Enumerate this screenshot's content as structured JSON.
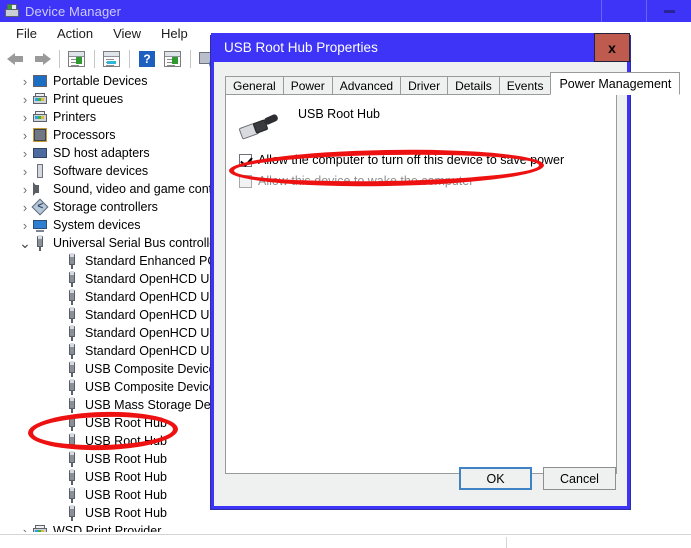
{
  "main_window": {
    "title": "Device Manager",
    "icon": "device-manager-icon",
    "minimize_label": "",
    "menus": [
      "File",
      "Action",
      "View",
      "Help"
    ],
    "toolbar_icons": [
      "back-arrow-icon",
      "forward-arrow-icon",
      "show-hide-console-tree-icon",
      "properties-icon",
      "help-icon",
      "update-driver-icon",
      "scan-for-hardware-changes-icon",
      "devices-by-type-icon"
    ]
  },
  "tree": {
    "items": [
      {
        "label": "Portable Devices",
        "indent": 1,
        "chevron": "collapsed",
        "icon": "portable-device-icon"
      },
      {
        "label": "Print queues",
        "indent": 1,
        "chevron": "collapsed",
        "icon": "printer-icon"
      },
      {
        "label": "Printers",
        "indent": 1,
        "chevron": "collapsed",
        "icon": "printer-icon"
      },
      {
        "label": "Processors",
        "indent": 1,
        "chevron": "collapsed",
        "icon": "processor-icon"
      },
      {
        "label": "SD host adapters",
        "indent": 1,
        "chevron": "collapsed",
        "icon": "sd-card-icon"
      },
      {
        "label": "Software devices",
        "indent": 1,
        "chevron": "collapsed",
        "icon": "software-device-icon"
      },
      {
        "label": "Sound, video and game controllers",
        "indent": 1,
        "chevron": "collapsed",
        "icon": "speaker-icon"
      },
      {
        "label": "Storage controllers",
        "indent": 1,
        "chevron": "collapsed",
        "icon": "storage-controller-icon"
      },
      {
        "label": "System devices",
        "indent": 1,
        "chevron": "collapsed",
        "icon": "system-device-icon"
      },
      {
        "label": "Universal Serial Bus controllers",
        "indent": 1,
        "chevron": "expanded",
        "icon": "usb-icon"
      },
      {
        "label": "Standard Enhanced PCI to USB Host Controller",
        "indent": 2,
        "chevron": "none",
        "icon": "usb-icon"
      },
      {
        "label": "Standard OpenHCD USB Host Controller",
        "indent": 2,
        "chevron": "none",
        "icon": "usb-icon"
      },
      {
        "label": "Standard OpenHCD USB Host Controller",
        "indent": 2,
        "chevron": "none",
        "icon": "usb-icon"
      },
      {
        "label": "Standard OpenHCD USB Host Controller",
        "indent": 2,
        "chevron": "none",
        "icon": "usb-icon"
      },
      {
        "label": "Standard OpenHCD USB Host Controller",
        "indent": 2,
        "chevron": "none",
        "icon": "usb-icon"
      },
      {
        "label": "Standard OpenHCD USB Host Controller",
        "indent": 2,
        "chevron": "none",
        "icon": "usb-icon"
      },
      {
        "label": "USB Composite Device",
        "indent": 2,
        "chevron": "none",
        "icon": "usb-icon"
      },
      {
        "label": "USB Composite Device",
        "indent": 2,
        "chevron": "none",
        "icon": "usb-icon"
      },
      {
        "label": "USB Mass Storage Device",
        "indent": 2,
        "chevron": "none",
        "icon": "usb-icon"
      },
      {
        "label": "USB Root Hub",
        "indent": 2,
        "chevron": "none",
        "icon": "usb-icon"
      },
      {
        "label": "USB Root Hub",
        "indent": 2,
        "chevron": "none",
        "icon": "usb-icon"
      },
      {
        "label": "USB Root Hub",
        "indent": 2,
        "chevron": "none",
        "icon": "usb-icon"
      },
      {
        "label": "USB Root Hub",
        "indent": 2,
        "chevron": "none",
        "icon": "usb-icon"
      },
      {
        "label": "USB Root Hub",
        "indent": 2,
        "chevron": "none",
        "icon": "usb-icon"
      },
      {
        "label": "USB Root Hub",
        "indent": 2,
        "chevron": "none",
        "icon": "usb-icon"
      },
      {
        "label": "WSD Print Provider",
        "indent": 1,
        "chevron": "collapsed",
        "icon": "printer-icon"
      }
    ]
  },
  "dialog": {
    "title": "USB Root Hub Properties",
    "close_label": "x",
    "tabs": [
      {
        "label": "General",
        "active": false
      },
      {
        "label": "Power",
        "active": false
      },
      {
        "label": "Advanced",
        "active": false
      },
      {
        "label": "Driver",
        "active": false
      },
      {
        "label": "Details",
        "active": false
      },
      {
        "label": "Events",
        "active": false
      },
      {
        "label": "Power Management",
        "active": true
      }
    ],
    "device_name": "USB Root Hub",
    "device_icon": "usb-plug-icon",
    "checkboxes": [
      {
        "label": "Allow the computer to turn off this device to save power",
        "checked": true,
        "disabled": false
      },
      {
        "label": "Allow this device to wake the computer",
        "checked": false,
        "disabled": true
      }
    ],
    "buttons": [
      {
        "label": "OK",
        "default": true
      },
      {
        "label": "Cancel",
        "default": false
      }
    ]
  },
  "annotations": {
    "color": "#ee1111",
    "shapes": [
      {
        "name": "red-circle-tree-usb-root-hub",
        "target": "USB Root Hub"
      },
      {
        "name": "red-circle-power-checkbox",
        "target": "Allow the computer to turn off this device to save power"
      }
    ]
  },
  "colors": {
    "title_bar": "#3d34f7",
    "dialog_border": "#3d34f7",
    "close_button": "#bf5a4e",
    "annotation_red": "#ee1111",
    "dialog_face": "#eff0f0"
  }
}
